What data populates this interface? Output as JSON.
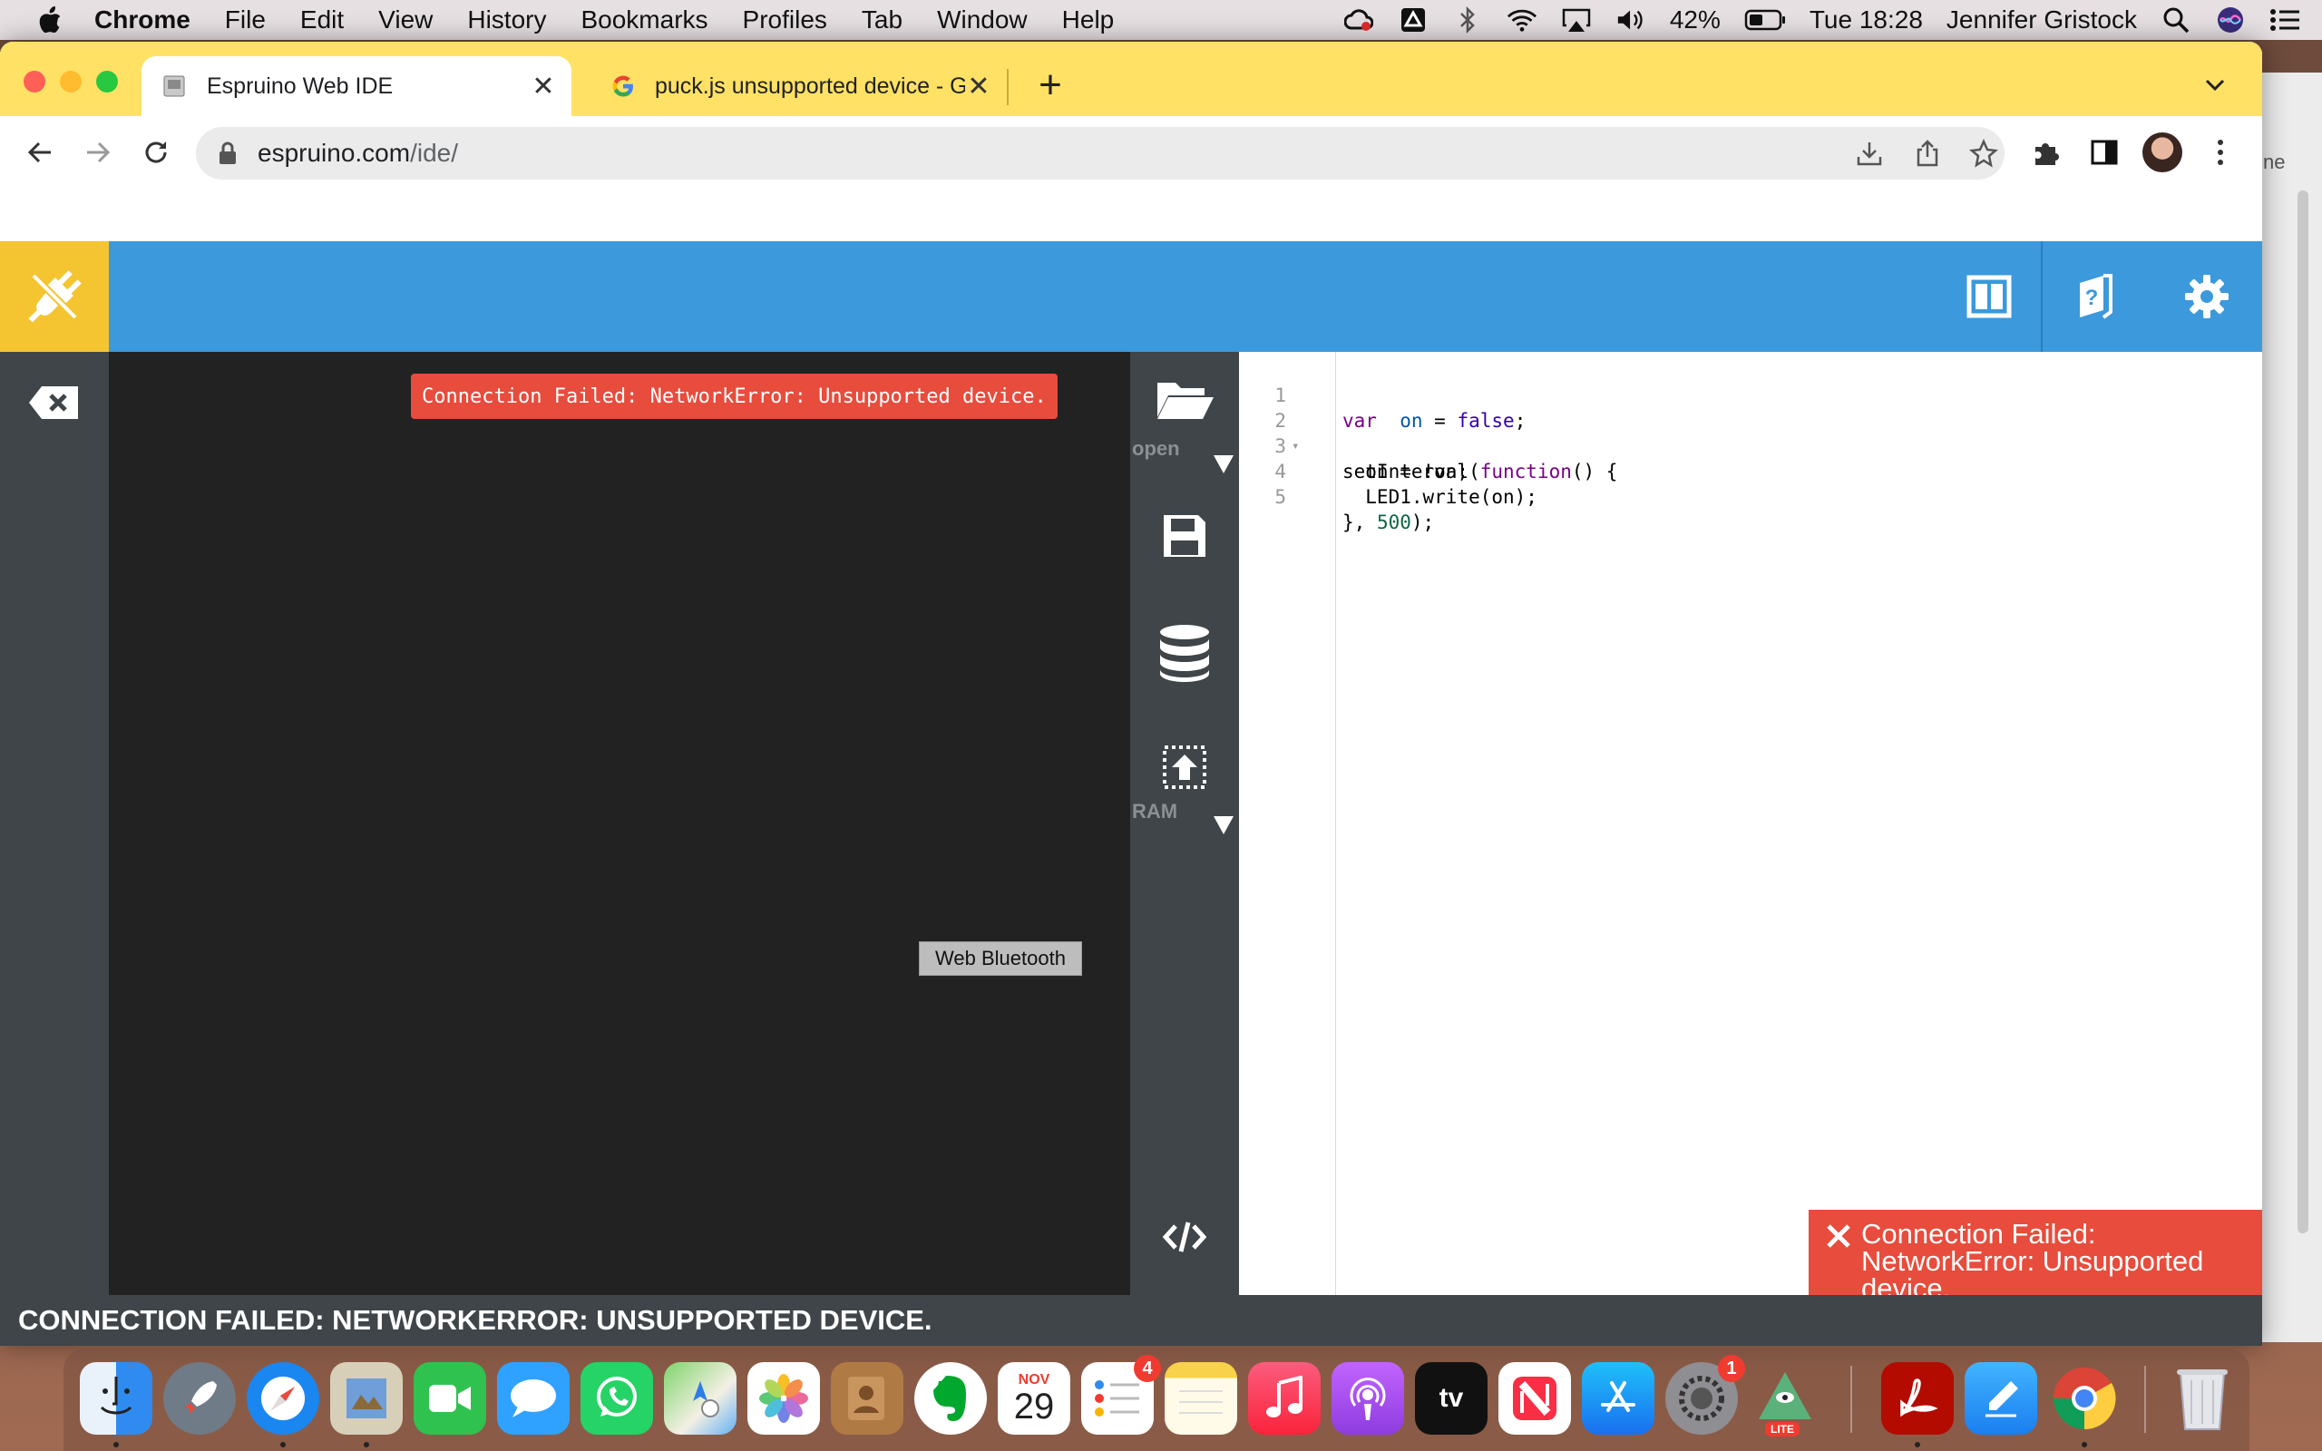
{
  "menubar": {
    "app": "Chrome",
    "items": [
      "File",
      "Edit",
      "View",
      "History",
      "Bookmarks",
      "Profiles",
      "Tab",
      "Window",
      "Help"
    ],
    "battery": "42%",
    "clock": "Tue 18:28",
    "user": "Jennifer Gristock"
  },
  "tabs": [
    {
      "title": "Espruino Web IDE",
      "active": true
    },
    {
      "title": "puck.js unsupported device - G",
      "active": false
    }
  ],
  "omnibox": {
    "host": "espruino.com",
    "path": "/ide/"
  },
  "background_window": {
    "partial_text": "ne"
  },
  "terminal": {
    "error": "Connection Failed: NetworkError: Unsupported device.",
    "button": "Web Bluetooth"
  },
  "sidebar": {
    "open_label": "open",
    "ram_label": "RAM"
  },
  "editor": {
    "lines": [
      {
        "n": "1",
        "html": "<span class=\"kw\">var</span>  <span class=\"var\">on</span> = <span class=\"kw2\">false</span>;"
      },
      {
        "n": "2",
        "fold": "▾",
        "html": "setInterval(<span class=\"kw\">function</span>() {"
      },
      {
        "n": "3",
        "html": "  on = !on;"
      },
      {
        "n": "4",
        "html": "  LED1.write(on);"
      },
      {
        "n": "5",
        "html": "}, <span class=\"num\">500</span>);"
      }
    ]
  },
  "notification": {
    "message": "Connection Failed: NetworkError: Unsupported device."
  },
  "status": {
    "text": "CONNECTION FAILED: NETWORKERROR: UNSUPPORTED DEVICE."
  },
  "dock": {
    "apps": [
      "finder",
      "launchpad",
      "safari",
      "preview",
      "facetime",
      "messages",
      "whatsapp",
      "maps",
      "photos",
      "contacts",
      "evernote",
      "calendar",
      "reminders",
      "notes",
      "music",
      "podcasts",
      "apple-tv",
      "news",
      "app-store",
      "system-preferences",
      "pyramid-lite",
      "acrobat",
      "pen-editor",
      "chrome",
      "trash"
    ],
    "calendar_month": "NOV",
    "calendar_day": "29",
    "tv_label": "tv",
    "reminders_badge": "4",
    "sysprefs_badge": "1",
    "lite_label": "LITE"
  },
  "colors": {
    "accent": "#3b99dc",
    "connect": "#f4c531",
    "error": "#e74c3c",
    "tabstrip": "#ffe165",
    "panel": "#3f4548",
    "terminal": "#222222"
  }
}
